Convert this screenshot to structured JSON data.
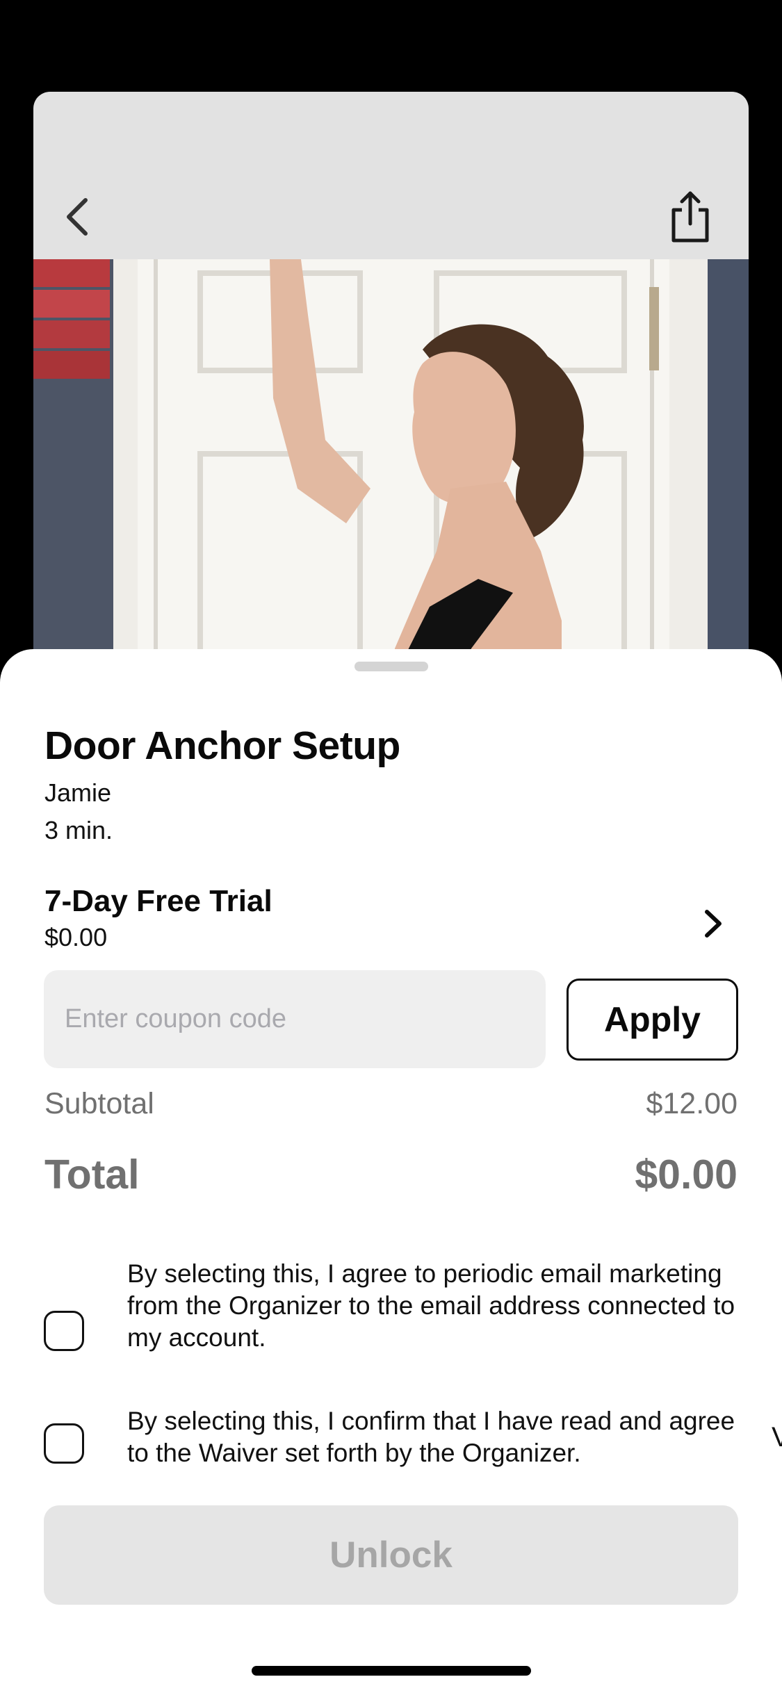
{
  "video_header": {
    "back_icon": "chevron-left-icon",
    "share_icon": "share-icon"
  },
  "product": {
    "title": "Door Anchor Setup",
    "author": "Jamie",
    "duration": "3 min."
  },
  "plan": {
    "name": "7-Day Free Trial",
    "price": "$0.00",
    "icon": "chevron-right-icon"
  },
  "coupon": {
    "value": "",
    "placeholder": "Enter coupon code",
    "apply_label": "Apply"
  },
  "summary": {
    "subtotal_label": "Subtotal",
    "subtotal_value": "$12.00",
    "total_label": "Total",
    "total_value": "$0.00"
  },
  "consents": [
    {
      "text": "By selecting this, I agree to periodic email marketing from the Organizer to the email address connected to my account.",
      "checked": false
    },
    {
      "text": "By selecting this, I confirm that I have read and agree to the Waiver set forth by the Organizer.",
      "checked": false
    }
  ],
  "edge_mark": "V",
  "unlock_label": "Unlock",
  "colors": {
    "sheet_bg": "#ffffff",
    "header_bg": "#e2e2e2",
    "input_bg": "#efefef",
    "disabled_button_bg": "#e5e5e5",
    "disabled_button_text": "#a6a6a6",
    "summary_text": "#707070"
  }
}
